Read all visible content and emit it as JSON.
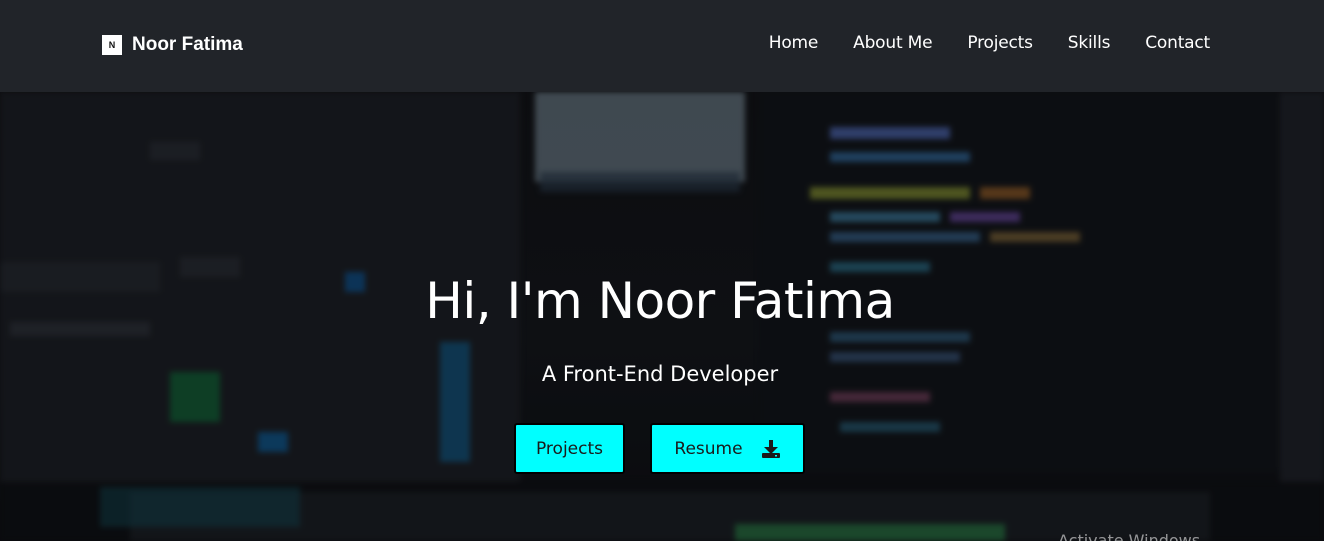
{
  "navbar": {
    "brand_logo_letter": "N",
    "brand_name": "Noor Fatima",
    "links": [
      {
        "label": "Home"
      },
      {
        "label": "About Me"
      },
      {
        "label": "Projects"
      },
      {
        "label": "Skills"
      },
      {
        "label": "Contact"
      }
    ]
  },
  "hero": {
    "title": "Hi, I'm Noor Fatima",
    "subtitle": "A Front-End Developer",
    "buttons": {
      "projects_label": "Projects",
      "resume_label": "Resume",
      "resume_icon": "download-icon"
    },
    "accent_color": "#00ffff"
  },
  "system_overlay": {
    "watermark_text": "Activate Windows"
  }
}
